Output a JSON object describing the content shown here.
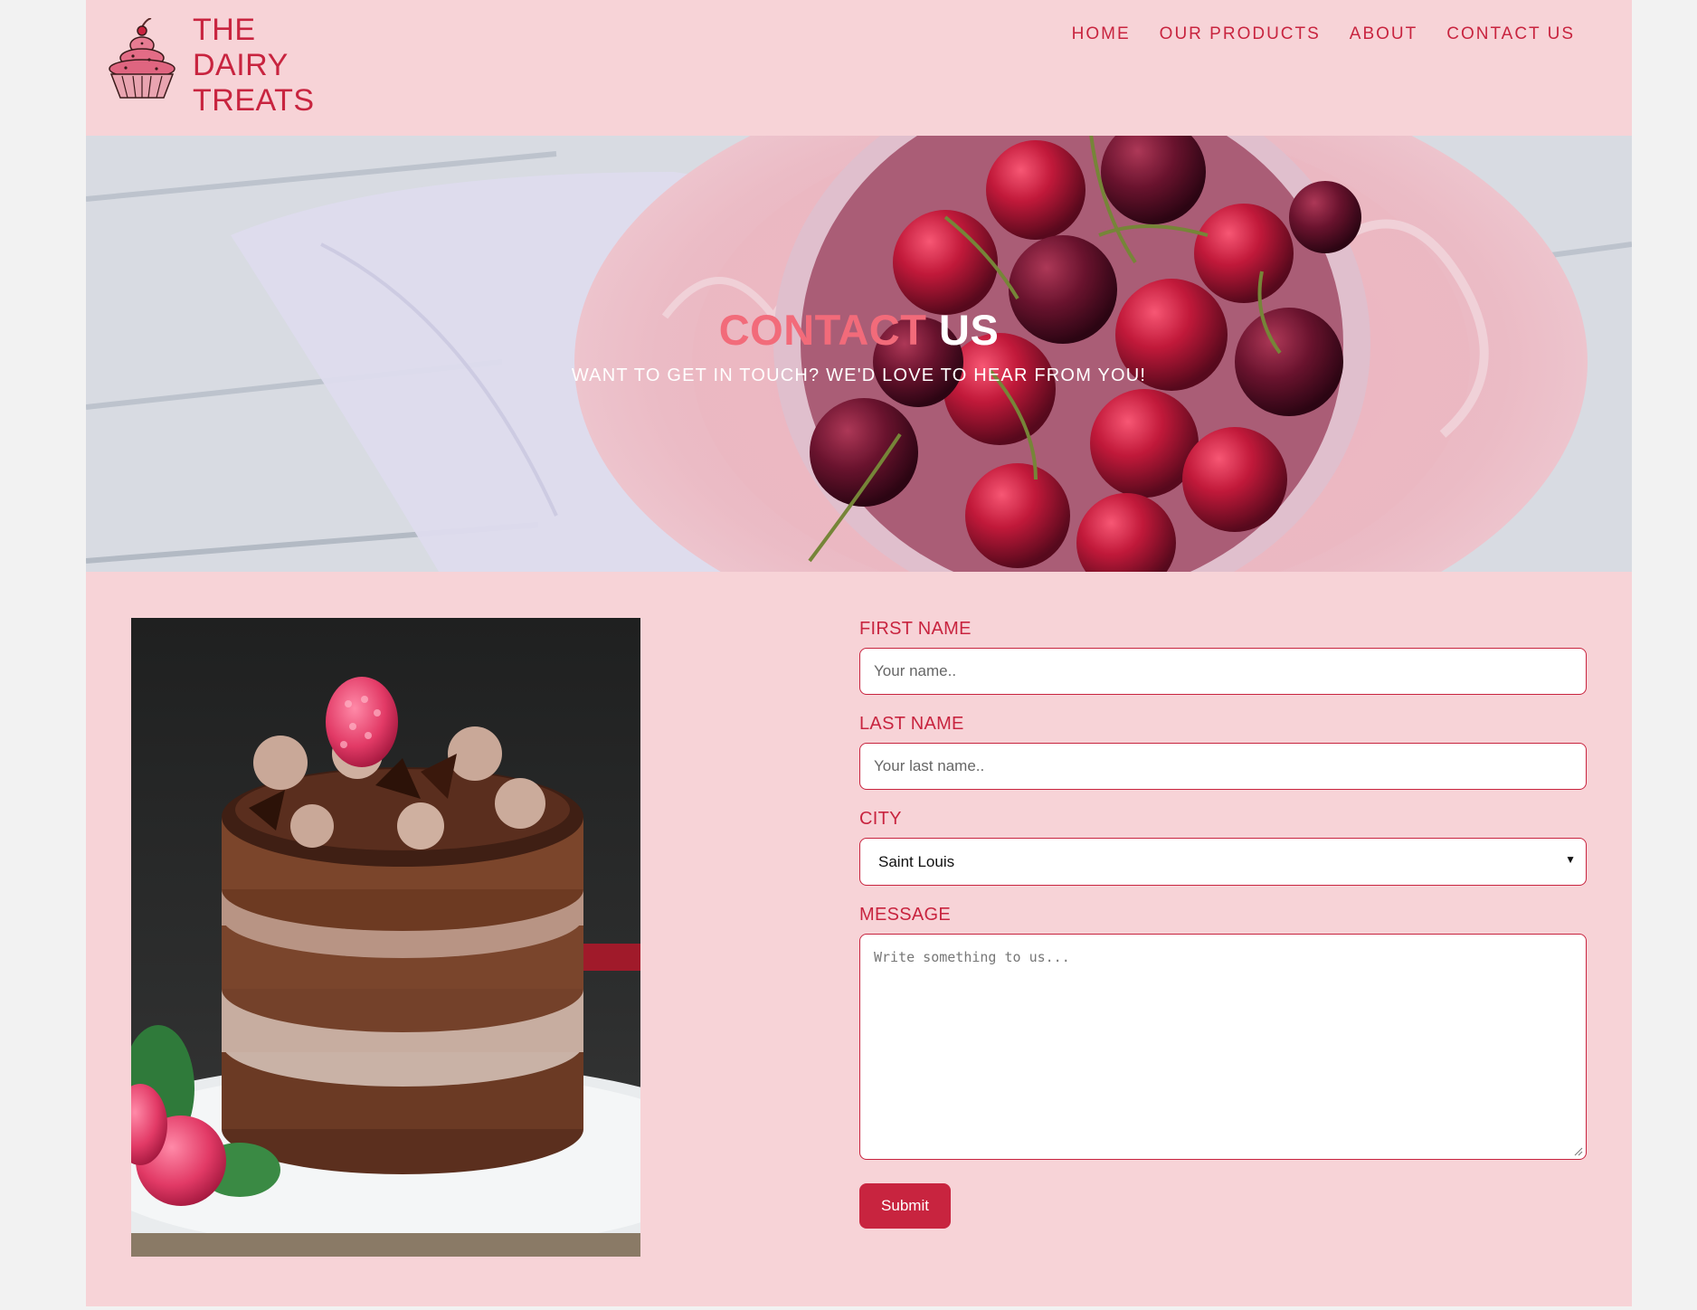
{
  "header": {
    "brand_lines": [
      "THE",
      "DAIRY",
      "TREATS"
    ],
    "logo_icon": "cupcake-icon",
    "nav": [
      {
        "label": "HOME"
      },
      {
        "label": "OUR PRODUCTS"
      },
      {
        "label": "ABOUT"
      },
      {
        "label": "CONTACT US"
      }
    ]
  },
  "hero": {
    "title_part1": "CONTACT",
    "title_part2": "US",
    "subtitle": "WANT TO GET IN TOUCH? WE'D LOVE TO HEAR FROM YOU!",
    "image": "cherries-bowl-image"
  },
  "content": {
    "image": "chocolate-cake-image"
  },
  "form": {
    "first_name_label": "FIRST NAME",
    "first_name_placeholder": "Your name..",
    "last_name_label": "LAST NAME",
    "last_name_placeholder": "Your last name..",
    "city_label": "CITY",
    "city_selected": "Saint Louis",
    "message_label": "MESSAGE",
    "message_placeholder": "Write something to us...",
    "submit_label": "Submit"
  },
  "colors": {
    "accent": "#c8243f",
    "page_bg": "#f7d3d7",
    "outer_bg": "#f2f2f2",
    "title_pink": "#f26b7a"
  }
}
